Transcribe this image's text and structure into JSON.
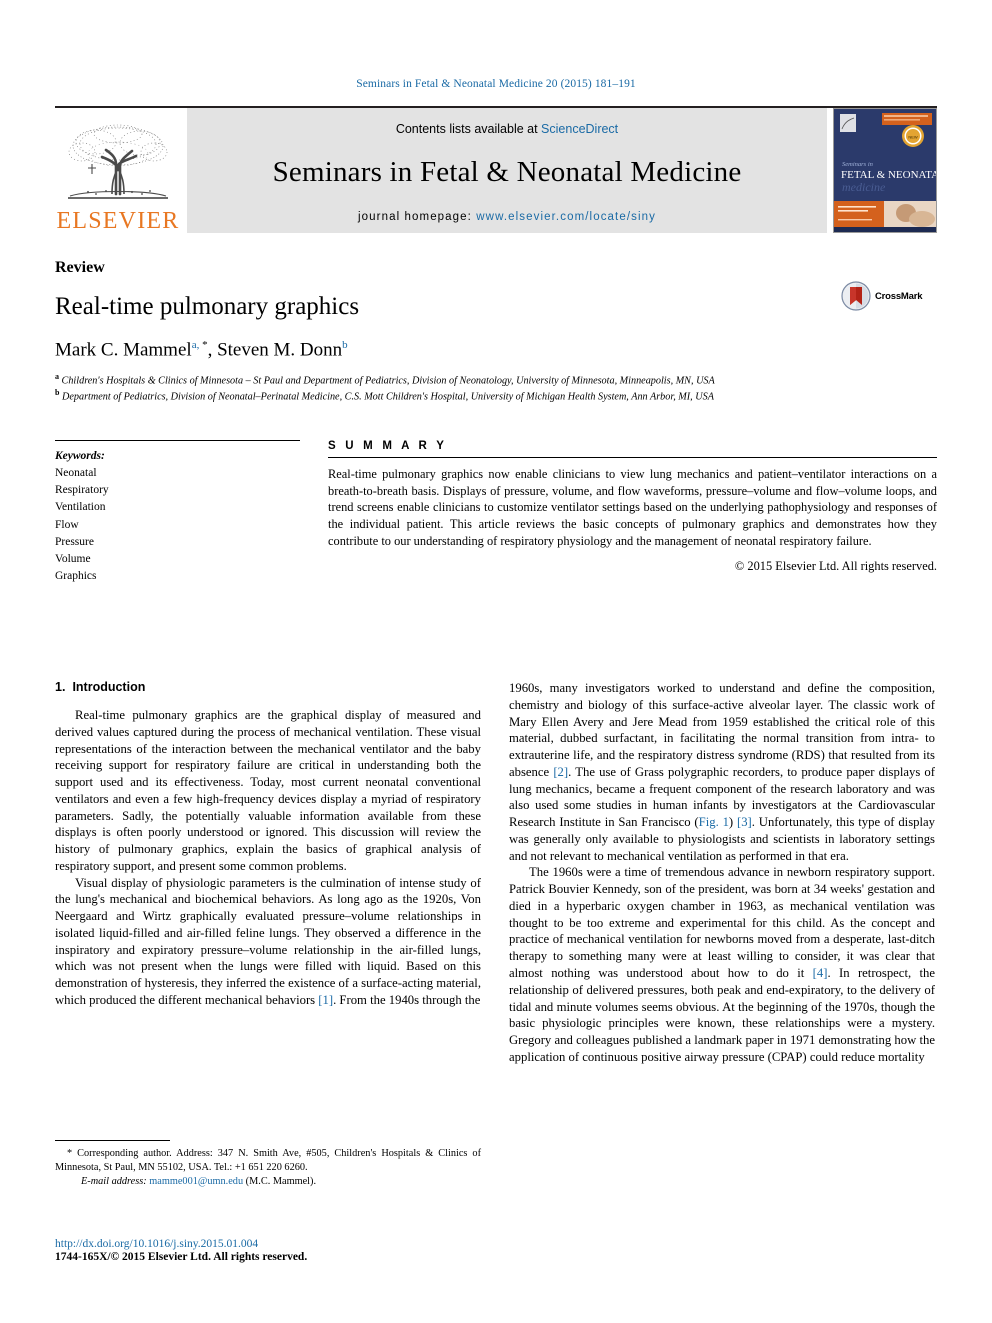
{
  "running_head": "Seminars in Fetal & Neonatal Medicine 20 (2015) 181–191",
  "masthead": {
    "publisher_name": "ELSEVIER",
    "contents_prefix": "Contents lists available at ",
    "sciencedirect": "ScienceDirect",
    "journal_name": "Seminars in Fetal & Neonatal Medicine",
    "homepage_label": "journal homepage: ",
    "homepage_url": "www.elsevier.com/locate/siny",
    "cover_title_line1": "Seminars in",
    "cover_title_line2": "FETAL & NEONATAL",
    "cover_title_line3": "medicine"
  },
  "article": {
    "type": "Review",
    "title": "Real-time pulmonary graphics",
    "authors_html": "Mark C. Mammel <sup>a, *</sup>, Steven M. Donn <sup>b</sup>",
    "author_1": "Mark C. Mammel",
    "author_2": "Steven M. Donn",
    "affiliation_a": "Children's Hospitals & Clinics of Minnesota – St Paul and Department of Pediatrics, Division of Neonatology, University of Minnesota, Minneapolis, MN, USA",
    "affiliation_b": "Department of Pediatrics, Division of Neonatal–Perinatal Medicine, C.S. Mott Children's Hospital, University of Michigan Health System, Ann Arbor, MI, USA",
    "crossmark_label": "CrossMark"
  },
  "keywords": {
    "heading": "Keywords:",
    "items": [
      "Neonatal",
      "Respiratory",
      "Ventilation",
      "Flow",
      "Pressure",
      "Volume",
      "Graphics"
    ]
  },
  "summary": {
    "heading": "S U M M A R Y",
    "text": "Real-time pulmonary graphics now enable clinicians to view lung mechanics and patient–ventilator interactions on a breath-to-breath basis. Displays of pressure, volume, and flow waveforms, pressure–volume and flow–volume loops, and trend screens enable clinicians to customize ventilator settings based on the underlying pathophysiology and responses of the individual patient. This article reviews the basic concepts of pulmonary graphics and demonstrates how they contribute to our understanding of respiratory physiology and the management of neonatal respiratory failure.",
    "copyright": "© 2015 Elsevier Ltd. All rights reserved."
  },
  "sections": {
    "intro_number": "1.",
    "intro_title": "Introduction"
  },
  "left_column": {
    "para_1_part_1": "Real-time pulmonary graphics are the graphical display of measured and derived values captured during the process of mechanical ventilation. These visual representations of the interaction between the mechanical ventilator and the baby receiving support for respiratory failure are critical in understanding both the support used and its effectiveness. Today, most current neonatal conventional ventilators and even a few high-frequency devices display a myriad of respiratory parameters. Sadly, the potentially valuable information available from these displays is often poorly understood or ignored. This discussion will review the history of pulmonary graphics, explain the basics of graphical analysis of respiratory support, and present some common problems.",
    "para_2_part_1": "Visual display of physiologic parameters is the culmination of intense study of the lung's mechanical and biochemical behaviors. As long ago as the 1920s, Von Neergaard and Wirtz graphically evaluated pressure–volume relationships in isolated liquid-filled and air-filled feline lungs. They observed a difference in the inspiratory and expiratory pressure–volume relationship in the air-filled lungs, which was not present when the lungs were filled with liquid. Based on this demonstration of hysteresis, they inferred the existence of a surface-acting material, which produced the different mechanical behaviors ",
    "para_2_ref": "[1]",
    "para_2_part_2": ". From the 1940s through the"
  },
  "right_column": {
    "para_1_part_1": "1960s, many investigators worked to understand and define the composition, chemistry and biology of this surface-active alveolar layer. The classic work of Mary Ellen Avery and Jere Mead from 1959 established the critical role of this material, dubbed surfactant, in facilitating the normal transition from intra- to extrauterine life, and the respiratory distress syndrome (RDS) that resulted from its absence ",
    "para_1_ref_1": "[2]",
    "para_1_part_2": ". The use of Grass polygraphic recorders, to produce paper displays of lung mechanics, became a frequent component of the research laboratory and was also used some studies in human infants by investigators at the Cardiovascular Research Institute in San Francisco (",
    "para_1_ref_2": "Fig. 1",
    "para_1_part_3": ") ",
    "para_1_ref_3": "[3]",
    "para_1_part_4": ". Unfortunately, this type of display was generally only available to physiologists and scientists in laboratory settings and not relevant to mechanical ventilation as performed in that era.",
    "para_2_part_1": "The 1960s were a time of tremendous advance in newborn respiratory support. Patrick Bouvier Kennedy, son of the president, was born at 34 weeks' gestation and died in a hyperbaric oxygen chamber in 1963, as mechanical ventilation was thought to be too extreme and experimental for this child. As the concept and practice of mechanical ventilation for newborns moved from a desperate, last-ditch therapy to something many were at least willing to consider, it was clear that almost nothing was understood about how to do it ",
    "para_2_ref": "[4]",
    "para_2_part_2": ". In retrospect, the relationship of delivered pressures, both peak and end-expiratory, to the delivery of tidal and minute volumes seems obvious. At the beginning of the 1970s, though the basic physiologic principles were known, these relationships were a mystery. Gregory and colleagues published a landmark paper in 1971 demonstrating how the application of continuous positive airway pressure (CPAP) could reduce mortality"
  },
  "footnote": {
    "marker": "*",
    "text": " Corresponding author. Address: 347 N. Smith Ave, #505, Children's Hospitals & Clinics of Minnesota, St Paul, MN 55102, USA. Tel.: +1 651 220 6260.",
    "email_label": "E-mail address:",
    "email": "mamme001@umn.edu",
    "email_suffix": " (M.C. Mammel)."
  },
  "footer": {
    "doi": "http://dx.doi.org/10.1016/j.siny.2015.01.004",
    "issn_line": "1744-165X/© 2015 Elsevier Ltd. All rights reserved."
  },
  "colors": {
    "link_blue": "#1a6aa5",
    "elsevier_orange": "#e87722",
    "band_grey": "#e3e3e3",
    "cover_navy": "#2b3a6b"
  }
}
